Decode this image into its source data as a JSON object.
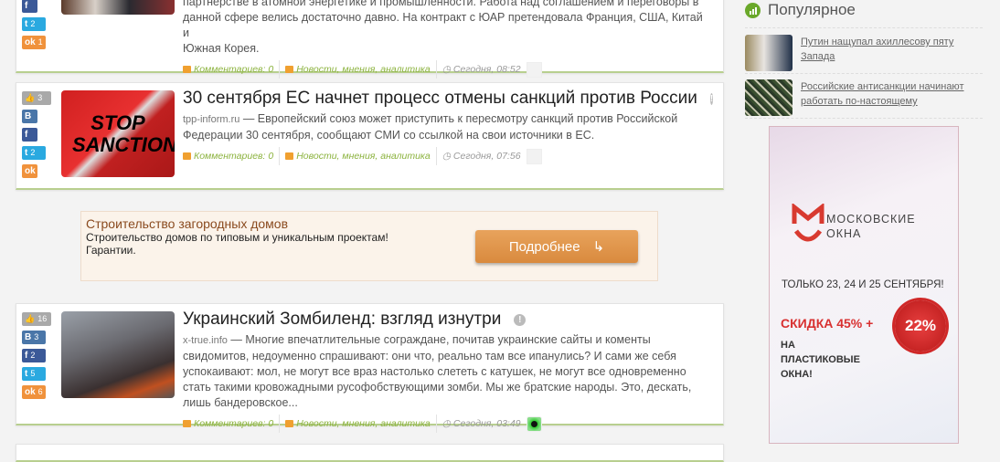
{
  "articles": [
    {
      "lines": [
        "партнерстве в атомной энергетике и промышленности. Работа над соглашением и переговоры в",
        "данной сфере велись достаточно давно. На контракт с ЮАР претендовала Франция, США, Китай и",
        "Южная Корея."
      ],
      "social": {
        "twitter": "2",
        "ok": "1"
      },
      "comments": "Комментариев: 0",
      "category": "Новости, мнения, аналитика",
      "time": "Сегодня, 08:52"
    },
    {
      "title": "30 сентября ЕС начнет процесс отмены санкций против России",
      "source": "tpp-inform.ru",
      "text": " — Европейский союз может приступить к пересмотру санкций против Российской Федерации 30 сентября, сообщают СМИ со ссылкой на свои источники в ЕС.",
      "image_text": "STOP SANCTIONS",
      "social": {
        "likes": "3",
        "twitter": "2"
      },
      "comments": "Комментариев: 0",
      "category": "Новости, мнения, аналитика",
      "time": "Сегодня, 07:56"
    },
    {
      "title": "Украинский Зомбиленд: взгляд изнутри",
      "source": "x-true.info",
      "text": " — Многие впечатлительные сограждане, почитав украинские сайты и коменты свидомитов, недоуменно спрашивают: они что, реально там все ипанулись? И сами же себя успокаивают: мол, не могут все враз настолько слететь с катушек, не могут все одновременно стать такими кровожадными русофобствующими зомби. Мы же братские народы. Это, дескать, лишь бандеровское...",
      "social": {
        "likes": "16",
        "vk": "3",
        "facebook": "2",
        "twitter": "5",
        "ok": "6"
      },
      "comments": "Комментариев: 0",
      "category": "Новости, мнения, аналитика",
      "time": "Сегодня, 03:49"
    }
  ],
  "ad": {
    "title": "Строительство загородных домов",
    "text": "Строительство домов по типовым и уникальным проектам! Гарантии.",
    "button": "Подробнее"
  },
  "sidebar": {
    "heading": "Популярное",
    "items": [
      "Путин нащупал ахиллесову пяту Запада",
      "Российские антисанкции начинают работать по-настоящему"
    ]
  },
  "banner": {
    "brand": "МОСКОВСКИЕ ОКНА",
    "dates": "ТОЛЬКО 23, 24 И 25 СЕНТЯБРЯ!",
    "discount": "СКИДКА 45% +",
    "extra": "22%",
    "product": "НА ПЛАСТИКОВЫЕ ОКНА!"
  },
  "colors": {
    "accent": "#8cb33f",
    "ad_button": "#e09a50",
    "banner_red": "#d83030"
  }
}
